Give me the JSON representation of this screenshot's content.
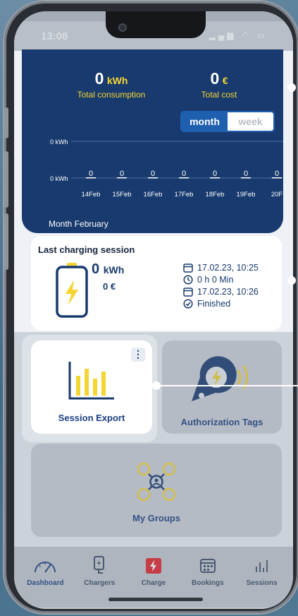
{
  "status_bar": {
    "time": "13:08",
    "icons": "▂▄▆ ◠ ▭"
  },
  "summary": {
    "consumption_value": "0",
    "consumption_unit": "kWh",
    "consumption_label": "Total consumption",
    "cost_value": "0",
    "cost_unit": "€",
    "cost_label": "Total cost",
    "period_options": [
      "month",
      "week"
    ],
    "selected_period": "month",
    "month_label": "Month February"
  },
  "chart_data": {
    "type": "bar",
    "categories": [
      "14Feb",
      "15Feb",
      "16Feb",
      "17Feb",
      "18Feb",
      "19Feb",
      "20F"
    ],
    "values": [
      0,
      0,
      0,
      0,
      0,
      0,
      0
    ],
    "data_labels": [
      "0",
      "0",
      "0",
      "0",
      "0",
      "0",
      "0"
    ],
    "y_tick_labels": [
      "0 kWh",
      "0 kWh"
    ],
    "ylim": [
      0,
      1
    ],
    "grid": true,
    "colors": {
      "grid": "#4f6f9e",
      "text": "#ffffff"
    }
  },
  "last_session": {
    "title": "Last charging session",
    "kwh_value": "0",
    "kwh_unit": "kWh",
    "cost": "0 €",
    "start": "17.02.23, 10:25",
    "duration": "0 h 0 Min",
    "end": "17.02.23, 10:26",
    "status": "Finished"
  },
  "tiles": {
    "export_label": "Session Export",
    "menu_glyph": "⋮",
    "auth_label": "Authorization Tags",
    "groups_label": "My Groups"
  },
  "tabbar": {
    "items": [
      {
        "label": "Dashboard",
        "icon": "gauge-icon"
      },
      {
        "label": "Chargers",
        "icon": "charger-icon"
      },
      {
        "label": "Charge",
        "icon": "lightning-icon"
      },
      {
        "label": "Bookings",
        "icon": "calendar-icon"
      },
      {
        "label": "Sessions",
        "icon": "bar-chart-icon"
      }
    ],
    "active": "Dashboard"
  },
  "colors": {
    "brand_navy": "#183a6e",
    "accent_yellow": "#f5d532",
    "accent_red": "#e3242b",
    "link_blue": "#1b3f82"
  }
}
